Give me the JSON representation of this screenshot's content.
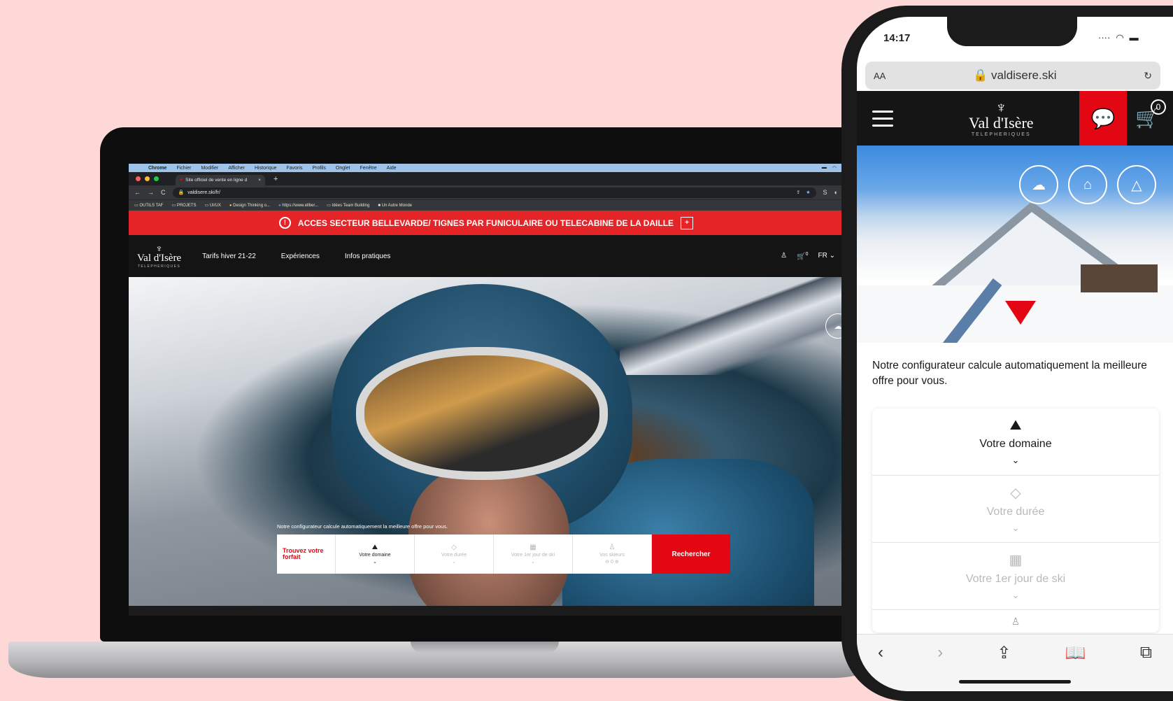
{
  "laptop": {
    "menubar": [
      "Chrome",
      "Fichier",
      "Modifier",
      "Afficher",
      "Historique",
      "Favoris",
      "Profils",
      "Onglet",
      "Fenêtre",
      "Aide"
    ],
    "tab_title": "Site officiel de vente en ligne d",
    "url": "valdisere.ski/fr/",
    "bookmarks": [
      "OUTILS TAF",
      "PROJETS",
      "UI/UX",
      "Design Thinking o...",
      "https://www.ellber...",
      "Idées Team Building",
      "Un Autre Monde"
    ],
    "alert_text": "ACCES SECTEUR BELLEVARDE/ TIGNES PAR FUNICULAIRE OU TELECABINE DE LA DAILLE",
    "logo_name": "Val d'Isère",
    "logo_sub": "TELEPHERIQUES",
    "nav_links": [
      "Tarifs hiver 21-22",
      "Expériences",
      "Infos pratiques"
    ],
    "cart_count": "0",
    "lang": "FR",
    "config_text": "Notre configurateur calcule automatiquement la meilleure offre pour vous.",
    "search": {
      "trouvez": "Trouvez votre forfait",
      "domaine": "Votre domaine",
      "duree": "Votre durée",
      "jour": "Votre 1er jour de ski",
      "skieurs": "Vos skieurs",
      "skieurs_count": "0",
      "button": "Rechercher"
    }
  },
  "phone": {
    "time": "14:17",
    "url": "valdisere.ski",
    "aa": "AA",
    "logo_name": "Val d'Isère",
    "logo_sub": "TELEPHERIQUES",
    "cart_count": "0",
    "intro": "Notre configurateur calcule automatiquement la meilleure offre pour vous.",
    "rows": {
      "domaine": "Votre domaine",
      "duree": "Votre durée",
      "jour": "Votre 1er jour de ski"
    }
  },
  "colors": {
    "brand_red": "#e30613",
    "background": "#fdd8d6"
  }
}
